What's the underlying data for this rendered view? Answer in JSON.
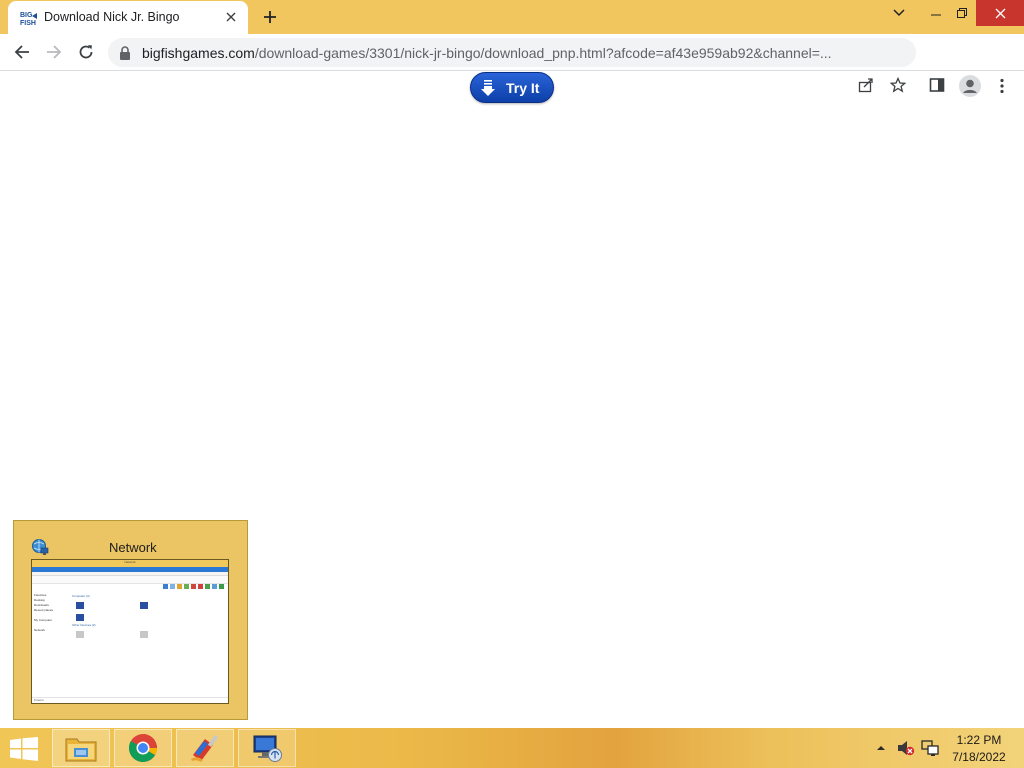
{
  "browser": {
    "tab": {
      "favicon": "bigfish-logo-icon",
      "title": "Download Nick Jr. Bingo",
      "close_icon": "close-icon"
    },
    "new_tab_icon": "plus-icon",
    "window_controls": [
      "chevron-down-icon",
      "minimize-icon",
      "restore-icon",
      "close-icon"
    ],
    "toolbar": {
      "back_icon": "arrow-left-icon",
      "forward_icon": "arrow-right-icon",
      "reload_icon": "reload-icon",
      "lock_icon": "lock-icon",
      "url_host": "bigfishgames.com",
      "url_rest": "/download-games/3301/nick-jr-bingo/download_pnp.html?afcode=af43e959ab92&channel=...",
      "share_icon": "share-icon",
      "bookmark_icon": "star-icon",
      "side_panel_icon": "side-panel-icon",
      "profile_icon": "profile-icon",
      "menu_icon": "kebab-menu-icon"
    }
  },
  "page": {
    "try_it_label": "Try It",
    "try_it_icon": "download-arrow-icon"
  },
  "thumbnail": {
    "title": "Network",
    "icon": "network-icon",
    "mini_window": {
      "title": "Network",
      "nav": [
        "Favorites",
        "Desktop",
        "Downloads",
        "Recent places",
        "",
        "My Computer",
        "",
        "Network"
      ],
      "group_computers": "Computer (3)",
      "group_other": "Other Devices (2)",
      "status": "5 items"
    }
  },
  "taskbar": {
    "start_icon": "windows-start-icon",
    "apps": [
      "file-explorer-icon",
      "chrome-icon",
      "ccleaner-icon",
      "network-icon"
    ],
    "tray": {
      "show_hidden_icon": "chevron-up-icon",
      "volume_icon": "volume-muted-icon",
      "network_icon": "network-tray-icon",
      "time": "1:22 PM",
      "date": "7/18/2022"
    }
  }
}
